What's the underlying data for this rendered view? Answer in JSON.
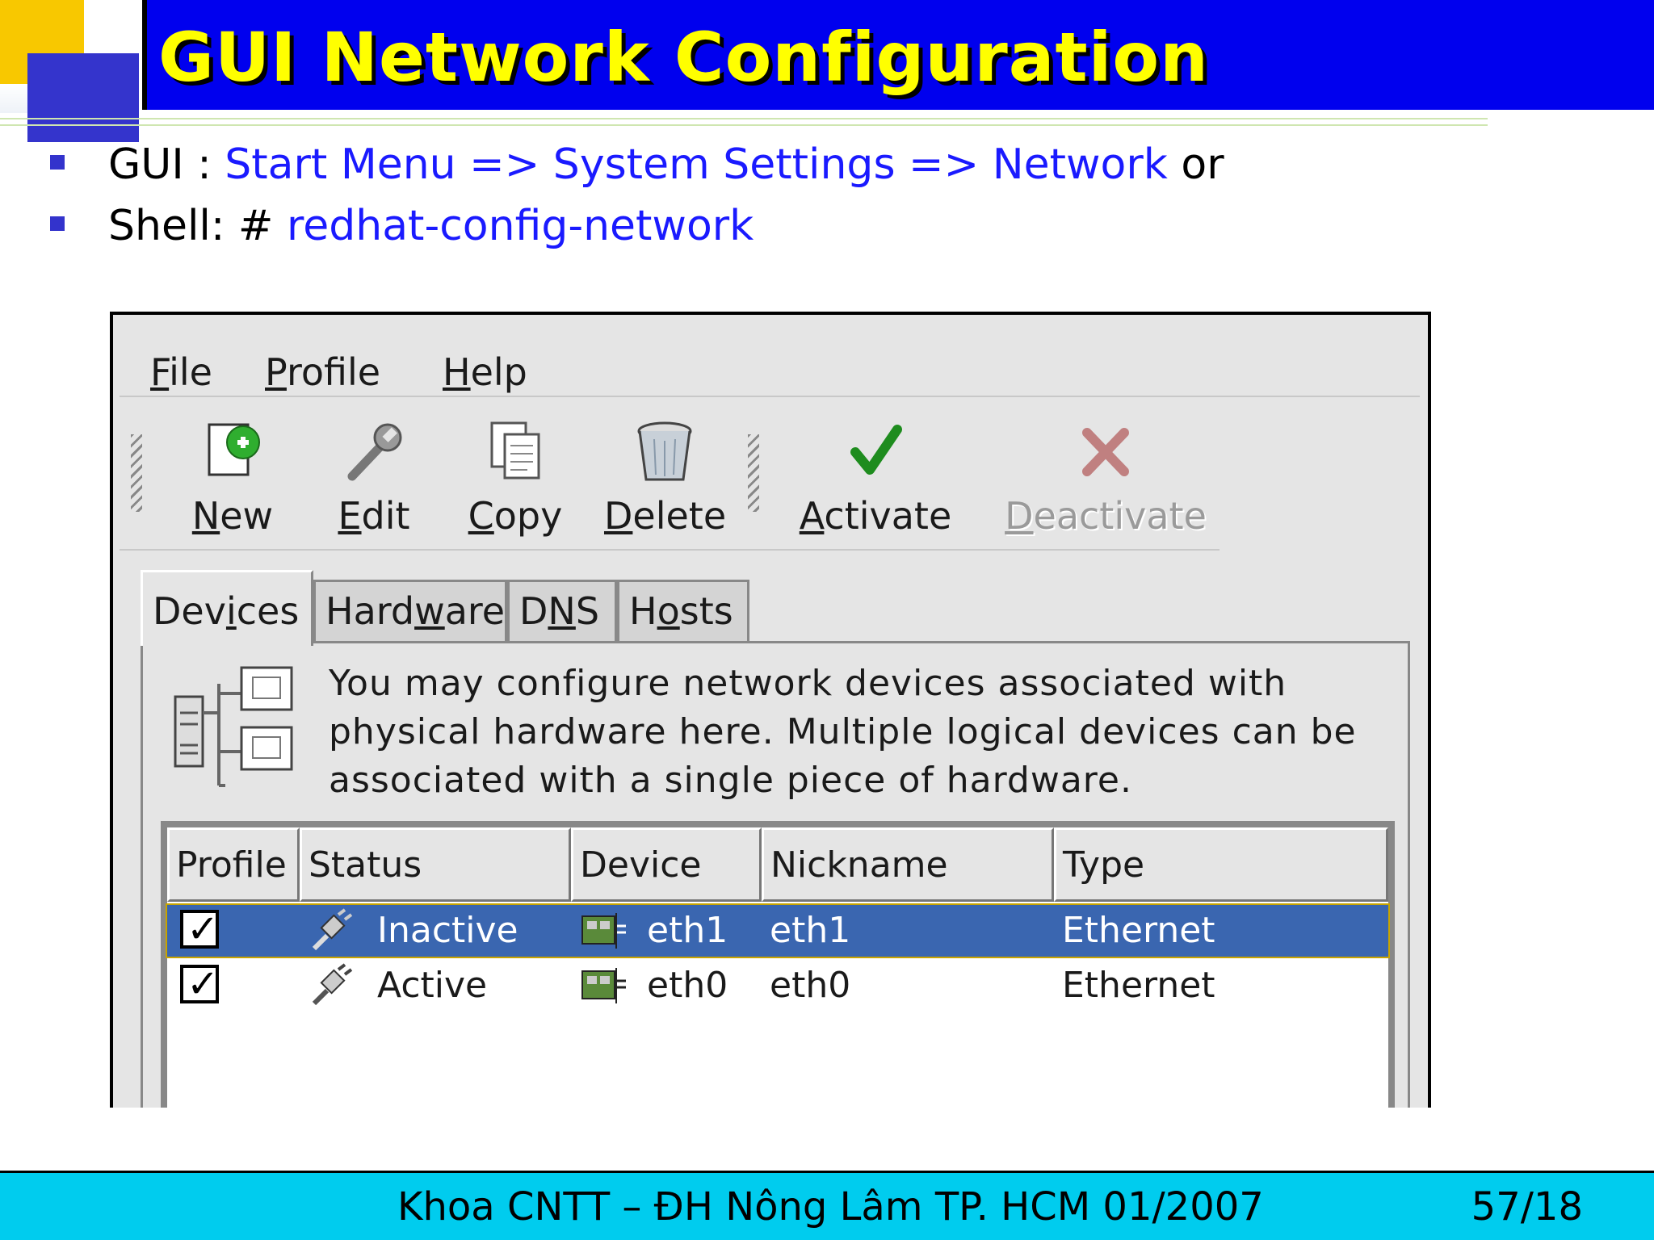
{
  "slide": {
    "title": "GUI Network Configuration",
    "bullets": [
      {
        "prefix": "GUI : ",
        "highlight": "Start Menu => System Settings => Network",
        "suffix": " or"
      },
      {
        "prefix": "Shell: # ",
        "highlight": "redhat-config-network",
        "suffix": ""
      }
    ],
    "footer": "Khoa CNTT – ĐH Nông Lâm TP. HCM 01/2007",
    "page_number": "57/18"
  },
  "colors": {
    "title_bg": "#0000ee",
    "title_text": "#ffff00",
    "highlight_text": "#1a1aff",
    "footer_bg": "#00ccee",
    "selected_row": "#3a66b0"
  },
  "window": {
    "menu": [
      {
        "mnemonic": "F",
        "rest": "ile"
      },
      {
        "mnemonic": "P",
        "rest": "rofile"
      },
      {
        "mnemonic": "H",
        "rest": "elp"
      }
    ],
    "toolbar": {
      "new": {
        "pre": "",
        "mn": "N",
        "post": "ew",
        "icon": "new-file-icon"
      },
      "edit": {
        "pre": "",
        "mn": "E",
        "post": "dit",
        "icon": "wrench-icon"
      },
      "copy": {
        "pre": "",
        "mn": "C",
        "post": "opy",
        "icon": "copy-icon"
      },
      "delete": {
        "pre": "",
        "mn": "D",
        "post": "elete",
        "icon": "trash-icon"
      },
      "activate": {
        "pre": "",
        "mn": "A",
        "post": "ctivate",
        "icon": "checkmark-icon"
      },
      "deactivate": {
        "pre": "",
        "mn": "D",
        "post": "eactivate",
        "icon": "x-icon",
        "disabled": true
      }
    },
    "tabs": {
      "devices": {
        "pre": "Dev",
        "mn": "i",
        "post": "ces",
        "active": true
      },
      "hardware": {
        "pre": "Hard",
        "mn": "w",
        "post": "are"
      },
      "dns": {
        "pre": "D",
        "mn": "N",
        "post": "S"
      },
      "hosts": {
        "pre": "H",
        "mn": "o",
        "post": "sts"
      }
    },
    "description": "You may configure network devices associated with physical hardware here.  Multiple logical devices can be associated with a single piece of hardware.",
    "table": {
      "columns": [
        "Profile",
        "Status",
        "Device",
        "Nickname",
        "Type"
      ],
      "rows": [
        {
          "profile_checked": "✓",
          "status": "Inactive",
          "device": "eth1",
          "nickname": "eth1",
          "type": "Ethernet",
          "selected": true
        },
        {
          "profile_checked": "✓",
          "status": "Active",
          "device": "eth0",
          "nickname": "eth0",
          "type": "Ethernet",
          "selected": false
        }
      ]
    }
  }
}
